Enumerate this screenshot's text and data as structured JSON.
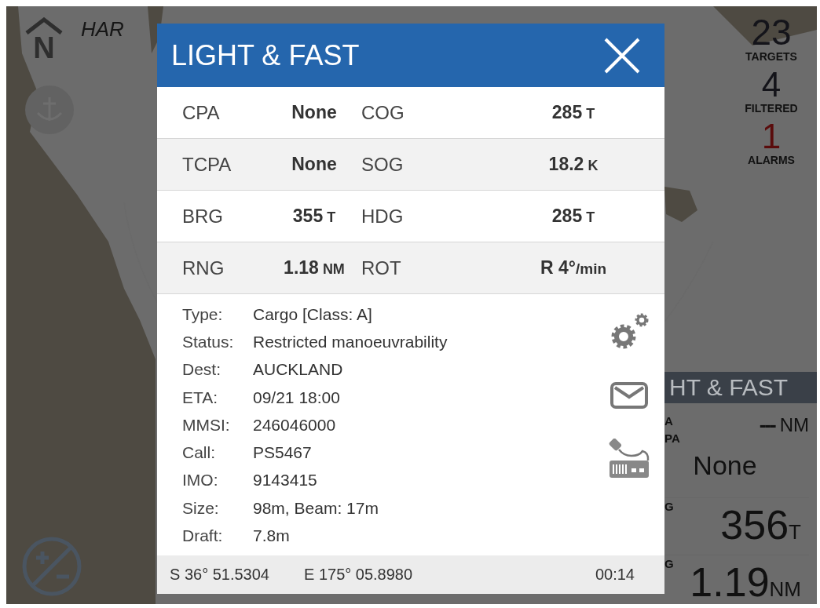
{
  "map": {
    "place_label": "HAR",
    "north_label": "N"
  },
  "counters": [
    {
      "value": "23",
      "label": "TARGETS",
      "kind": "normal"
    },
    {
      "value": "4",
      "label": "FILTERED",
      "kind": "normal"
    },
    {
      "value": "1",
      "label": "ALARMS",
      "kind": "alarm"
    }
  ],
  "side_panel": {
    "title": "HT & FAST",
    "readings": [
      {
        "labels": [
          "A",
          "PA"
        ],
        "value": "---",
        "unit": "NM",
        "kind": "small"
      },
      {
        "value": "None",
        "kind": "medium"
      },
      {
        "labels": [
          "G"
        ],
        "value": "356",
        "unit": "T",
        "kind": "large"
      },
      {
        "labels": [
          "G"
        ],
        "value": "1.19",
        "unit": "NM",
        "kind": "large"
      }
    ]
  },
  "dialog": {
    "title": "LIGHT & FAST",
    "grid": [
      [
        {
          "label": "CPA",
          "value": "None"
        },
        {
          "label": "COG",
          "value": "285",
          "unit": "T"
        }
      ],
      [
        {
          "label": "TCPA",
          "value": "None"
        },
        {
          "label": "SOG",
          "value": "18.2",
          "unit": "K"
        }
      ],
      [
        {
          "label": "BRG",
          "value": "355",
          "unit": "T"
        },
        {
          "label": "HDG",
          "value": "285",
          "unit": "T"
        }
      ],
      [
        {
          "label": "RNG",
          "value": "1.18",
          "unit": "NM"
        },
        {
          "label": "ROT",
          "value": "R 4°",
          "unit": "/min"
        }
      ]
    ],
    "details": [
      {
        "label": "Type:",
        "value": "Cargo [Class: A]"
      },
      {
        "label": "Status:",
        "value": "Restricted manoeuvrability"
      },
      {
        "label": "Dest:",
        "value": "AUCKLAND"
      },
      {
        "label": "ETA:",
        "value": "09/21 18:00"
      },
      {
        "label": "MMSI:",
        "value": "246046000"
      },
      {
        "label": "Call:",
        "value": "PS5467"
      },
      {
        "label": "IMO:",
        "value": "9143415"
      },
      {
        "label": "Size:",
        "value": "98m, Beam: 17m"
      },
      {
        "label": "Draft:",
        "value": "7.8m"
      }
    ],
    "footer": {
      "latitude": "S 36° 51.5304",
      "longitude": "E 175° 05.8980",
      "time": "00:14"
    }
  }
}
